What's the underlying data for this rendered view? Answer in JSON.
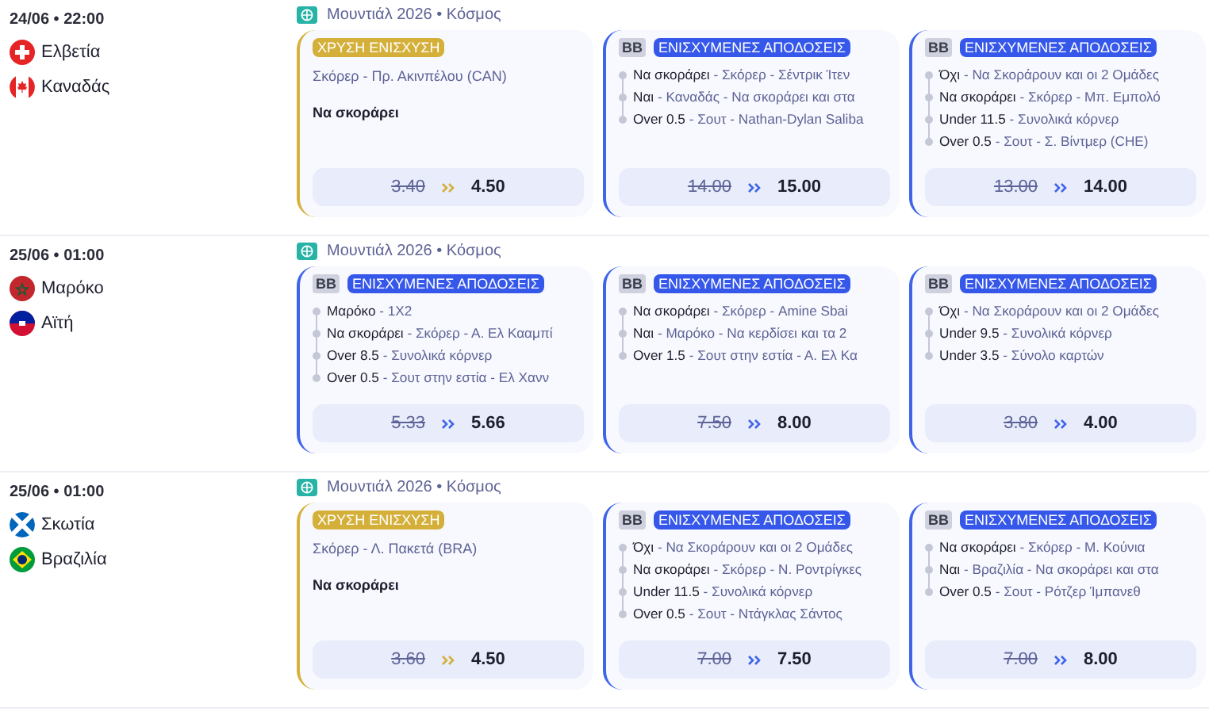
{
  "matches": [
    {
      "time": "24/06 • 22:00",
      "teams": [
        {
          "name": "Ελβετία",
          "kind": "cross"
        },
        {
          "name": "Καναδάς",
          "kind": "leaf"
        }
      ],
      "league": "Μουντιάλ 2026 • Κόσμος",
      "cards": [
        {
          "kind": "golden",
          "badge": "ΧΡΥΣΗ ΕΝΙΣΧΥΣΗ",
          "market": "Σκόρερ - Πρ. Ακινπέλου (CAN)",
          "selection": "Να σκοράρει",
          "old_odds": "3.40",
          "new_odds": "4.50"
        },
        {
          "kind": "bb",
          "tag": "BB",
          "badge": "ΕΝΙΣΧΥΜΕΝΕΣ ΑΠΟΔΟΣΕΙΣ",
          "legs": [
            {
              "selection": "Να σκοράρει",
              "market": "- Σκόρερ - Σέντρικ Ίτεν"
            },
            {
              "selection": "Ναι",
              "market": "- Καναδάς - Να σκοράρει και στα"
            },
            {
              "selection": "Over 0.5",
              "market": "- Σουτ - Nathan-Dylan Saliba"
            }
          ],
          "old_odds": "14.00",
          "new_odds": "15.00"
        },
        {
          "kind": "bb",
          "tag": "BB",
          "badge": "ΕΝΙΣΧΥΜΕΝΕΣ ΑΠΟΔΟΣΕΙΣ",
          "legs": [
            {
              "selection": "Όχι",
              "market": "- Να Σκοράρουν και οι 2 Ομάδες"
            },
            {
              "selection": "Να σκοράρει",
              "market": "- Σκόρερ - Μπ. Εμπολό"
            },
            {
              "selection": "Under 11.5",
              "market": "- Συνολικά κόρνερ"
            },
            {
              "selection": "Over 0.5",
              "market": "- Σουτ - Σ. Βίντμερ (CHE)"
            }
          ],
          "old_odds": "13.00",
          "new_odds": "14.00"
        }
      ]
    },
    {
      "time": "25/06 • 01:00",
      "teams": [
        {
          "name": "Μαρόκο",
          "kind": "star"
        },
        {
          "name": "Αϊτή",
          "kind": "bicolor"
        }
      ],
      "league": "Μουντιάλ 2026 • Κόσμος",
      "cards": [
        {
          "kind": "bb",
          "tag": "BB",
          "badge": "ΕΝΙΣΧΥΜΕΝΕΣ ΑΠΟΔΟΣΕΙΣ",
          "legs": [
            {
              "selection": "Μαρόκο",
              "market": "- 1X2"
            },
            {
              "selection": "Να σκοράρει",
              "market": "- Σκόρερ - Α. Ελ Κααμπί"
            },
            {
              "selection": "Over 8.5",
              "market": "- Συνολικά κόρνερ"
            },
            {
              "selection": "Over 0.5",
              "market": "- Σουτ στην εστία - Ελ Χανν"
            }
          ],
          "old_odds": "5.33",
          "new_odds": "5.66"
        },
        {
          "kind": "bb",
          "tag": "BB",
          "badge": "ΕΝΙΣΧΥΜΕΝΕΣ ΑΠΟΔΟΣΕΙΣ",
          "legs": [
            {
              "selection": "Να σκοράρει",
              "market": "- Σκόρερ - Amine Sbai"
            },
            {
              "selection": "Ναι",
              "market": "- Μαρόκο - Να κερδίσει και τα 2"
            },
            {
              "selection": "Over 1.5",
              "market": "- Σουτ στην εστία - Α. Ελ Κα"
            }
          ],
          "old_odds": "7.50",
          "new_odds": "8.00"
        },
        {
          "kind": "bb",
          "tag": "BB",
          "badge": "ΕΝΙΣΧΥΜΕΝΕΣ ΑΠΟΔΟΣΕΙΣ",
          "legs": [
            {
              "selection": "Όχι",
              "market": "- Να Σκοράρουν και οι 2 Ομάδες"
            },
            {
              "selection": "Under 9.5",
              "market": "- Συνολικά κόρνερ"
            },
            {
              "selection": "Under 3.5",
              "market": "- Σύνολο καρτών"
            }
          ],
          "old_odds": "3.80",
          "new_odds": "4.00"
        }
      ]
    },
    {
      "time": "25/06 • 01:00",
      "teams": [
        {
          "name": "Σκωτία",
          "kind": "saltire"
        },
        {
          "name": "Βραζιλία",
          "kind": "diamond"
        }
      ],
      "league": "Μουντιάλ 2026 • Κόσμος",
      "cards": [
        {
          "kind": "golden",
          "badge": "ΧΡΥΣΗ ΕΝΙΣΧΥΣΗ",
          "market": "Σκόρερ - Λ. Πακετά (BRA)",
          "selection": "Να σκοράρει",
          "old_odds": "3.60",
          "new_odds": "4.50"
        },
        {
          "kind": "bb",
          "tag": "BB",
          "badge": "ΕΝΙΣΧΥΜΕΝΕΣ ΑΠΟΔΟΣΕΙΣ",
          "legs": [
            {
              "selection": "Όχι",
              "market": "- Να Σκοράρουν και οι 2 Ομάδες"
            },
            {
              "selection": "Να σκοράρει",
              "market": "- Σκόρερ - Ν. Ροντρίγκες"
            },
            {
              "selection": "Under 11.5",
              "market": "- Συνολικά κόρνερ"
            },
            {
              "selection": "Over 0.5",
              "market": "- Σουτ - Ντάγκλας Σάντος"
            }
          ],
          "old_odds": "7.00",
          "new_odds": "7.50"
        },
        {
          "kind": "bb",
          "tag": "BB",
          "badge": "ΕΝΙΣΧΥΜΕΝΕΣ ΑΠΟΔΟΣΕΙΣ",
          "legs": [
            {
              "selection": "Να σκοράρει",
              "market": "- Σκόρερ - Μ. Κούνια"
            },
            {
              "selection": "Ναι",
              "market": "- Βραζιλία - Να σκοράρει και στα"
            },
            {
              "selection": "Over 0.5",
              "market": "- Σουτ - Ρότζερ Ίμπανεθ"
            }
          ],
          "old_odds": "7.00",
          "new_odds": "8.00"
        }
      ]
    }
  ]
}
